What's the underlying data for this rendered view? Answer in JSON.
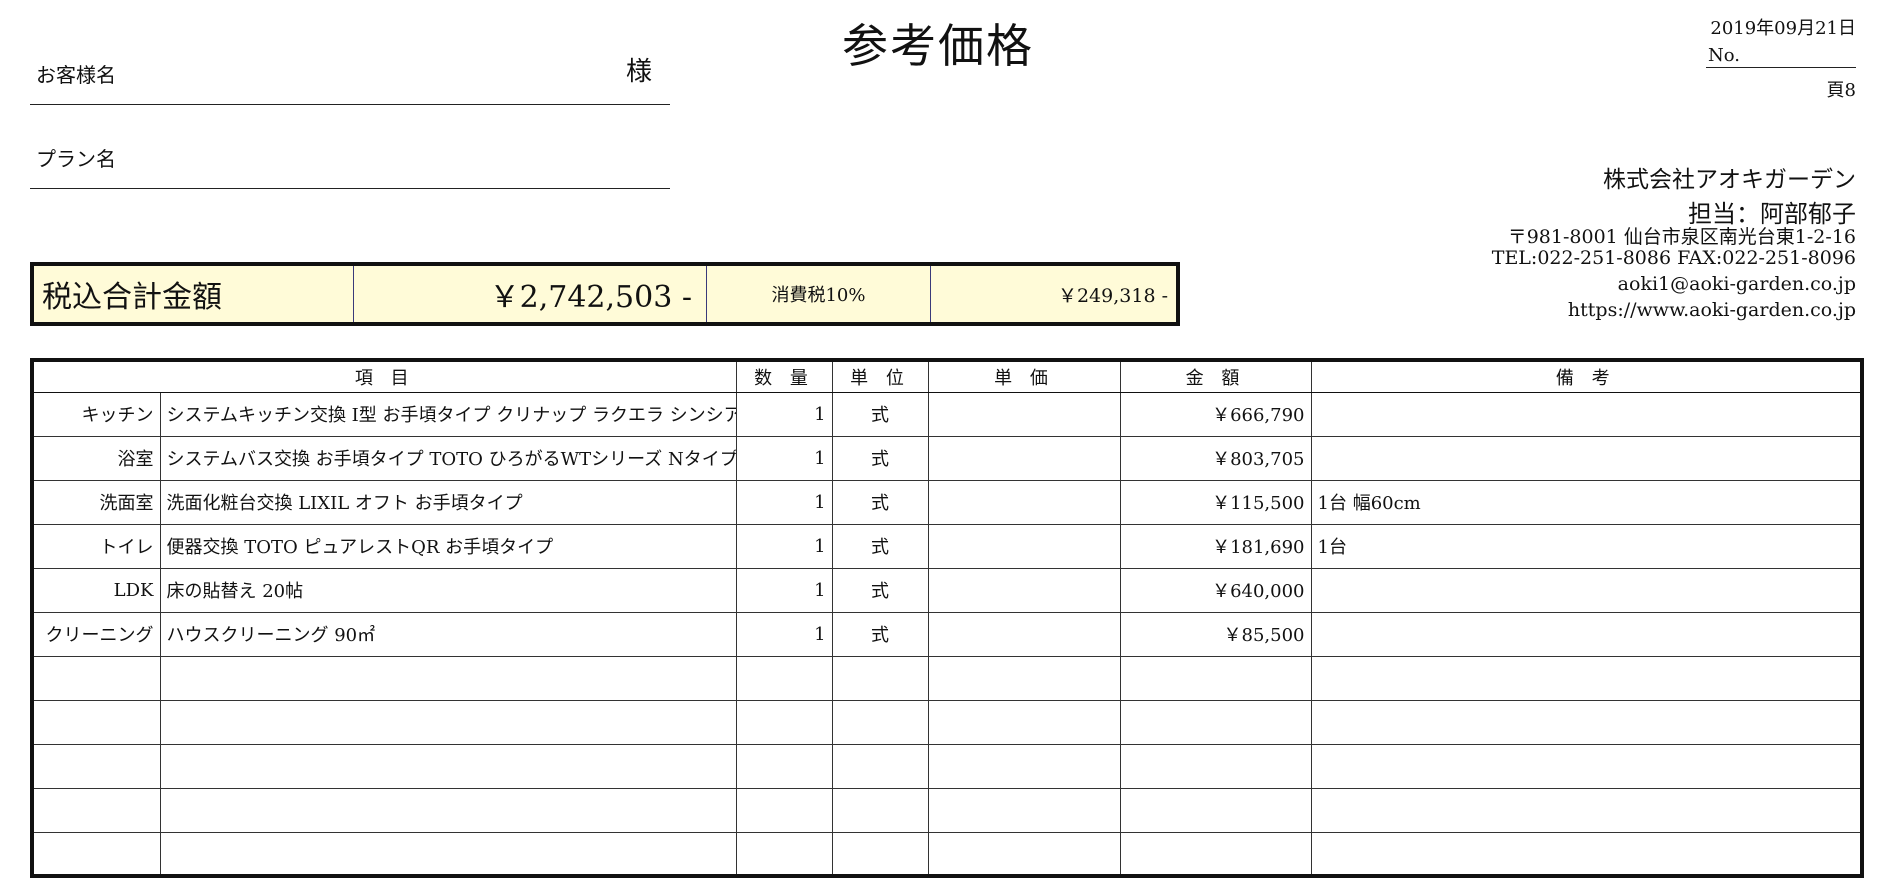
{
  "document": {
    "title": "参考価格",
    "customer_label": "お客様名",
    "customer_suffix": "様",
    "plan_label": "プラン名"
  },
  "header_right": {
    "date": "2019年09月21日",
    "number_label": "No.",
    "page": "頁8",
    "company": "株式会社アオキガーデン",
    "staff": "担当：阿部郁子",
    "address": "〒981-8001 仙台市泉区南光台東1-2-16",
    "tel_fax": "TEL:022-251-8086 FAX:022-251-8096",
    "email": "aoki1@aoki-garden.co.jp",
    "website": "https://www.aoki-garden.co.jp"
  },
  "totals": {
    "label": "税込合計金額",
    "amount": "￥2,742,503 -",
    "tax_label": "消費税10%",
    "tax_amount": "￥249,318 -",
    "background_color": "#fffbd8"
  },
  "table": {
    "headers": [
      "項 目",
      "数 量",
      "単 位",
      "単 価",
      "金 額",
      "備 考"
    ],
    "rows": [
      {
        "category": "キッチン",
        "item": "システムキッチン交換 I型 お手頃タイプ クリナップ ラクエラ シンシアシリーズ",
        "qty": "1",
        "unit": "式",
        "unit_price": "",
        "amount": "￥666,790",
        "note": ""
      },
      {
        "category": "浴室",
        "item": "システムバス交換 お手頃タイプ TOTO ひろがるWTシリーズ Nタイプ",
        "qty": "1",
        "unit": "式",
        "unit_price": "",
        "amount": "￥803,705",
        "note": ""
      },
      {
        "category": "洗面室",
        "item": "洗面化粧台交換 LIXIL オフト お手頃タイプ",
        "qty": "1",
        "unit": "式",
        "unit_price": "",
        "amount": "￥115,500",
        "note": "1台 幅60cm"
      },
      {
        "category": "トイレ",
        "item": "便器交換 TOTO ピュアレストQR お手頃タイプ",
        "qty": "1",
        "unit": "式",
        "unit_price": "",
        "amount": "￥181,690",
        "note": "1台"
      },
      {
        "category": "LDK",
        "item": "床の貼替え 20帖",
        "qty": "1",
        "unit": "式",
        "unit_price": "",
        "amount": "￥640,000",
        "note": ""
      },
      {
        "category": "クリーニング",
        "item": "ハウスクリーニング 90㎡",
        "qty": "1",
        "unit": "式",
        "unit_price": "",
        "amount": "￥85,500",
        "note": ""
      },
      {
        "category": "",
        "item": "",
        "qty": "",
        "unit": "",
        "unit_price": "",
        "amount": "",
        "note": ""
      },
      {
        "category": "",
        "item": "",
        "qty": "",
        "unit": "",
        "unit_price": "",
        "amount": "",
        "note": ""
      },
      {
        "category": "",
        "item": "",
        "qty": "",
        "unit": "",
        "unit_price": "",
        "amount": "",
        "note": ""
      },
      {
        "category": "",
        "item": "",
        "qty": "",
        "unit": "",
        "unit_price": "",
        "amount": "",
        "note": ""
      },
      {
        "category": "",
        "item": "",
        "qty": "",
        "unit": "",
        "unit_price": "",
        "amount": "",
        "note": ""
      }
    ]
  }
}
